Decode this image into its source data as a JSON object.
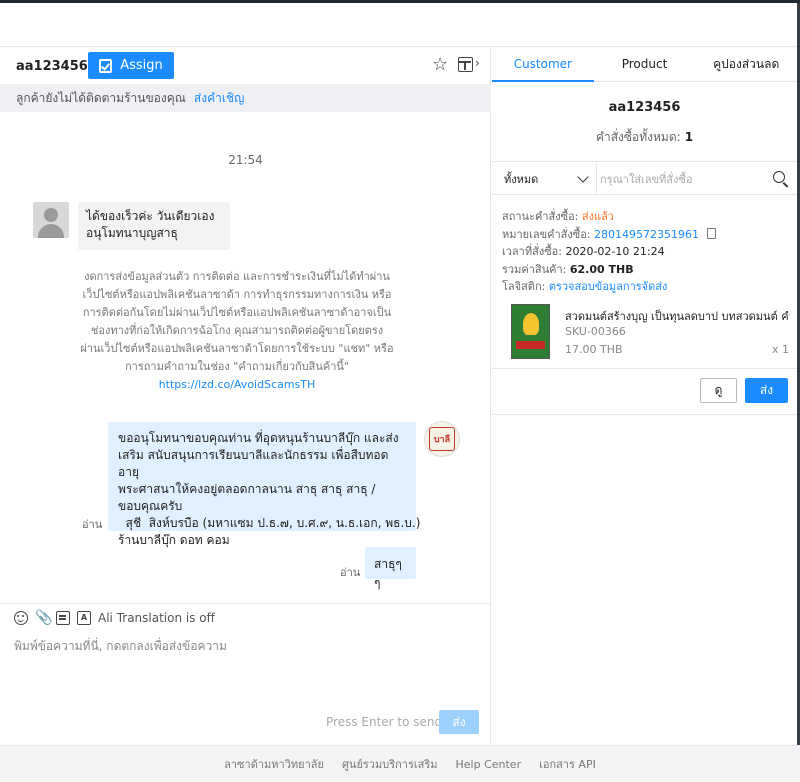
{
  "chat": {
    "username": "aa123456",
    "assign_label": "Assign",
    "invite_text": "ลูกค้ายังไม่ได้ติดตามร้านของคุณ",
    "invite_link": "ส่งคำเชิญ",
    "time": "21:54",
    "message_in": {
      "line1": "ได้ของเร็วค่ะ  วันเดียวเอง",
      "line2": "อนุโมทนาบุญสาธุ"
    },
    "notice": {
      "lines": [
        "งดการส่งข้อมูลส่วนตัว การติดต่อ และการชำระเงินที่ไม่ได้ทำผ่าน",
        "เว็ปไซต์หรือแอปพลิเคชันลาซาด้า การทำธุรกรรมทางการเงิน หรือ",
        "การติดต่อกันโดยไม่ผ่านเว็ปไซต์หรือแอปพลิเคชันลาซาด้าอาจเป็น",
        "ช่องทางที่ก่อให้เกิดการฉ้อโกง คุณสามารถติดต่อผู้ขายโดยตรง",
        "ผ่านเว็ปไซต์หรือแอปพลิเคชันลาซาด้าโดยการใช้ระบบ \"แชท\" หรือ",
        "การถามคำถามในช่อง \"คำถามเกี่ยวกับสินค้านี้\""
      ],
      "link": "https://lzd.co/AvoidScamsTH"
    },
    "seller_logo": "บาลี",
    "message_out1": {
      "lines": [
        "ขออนุโมทนาขอบคุณท่าน ที่อุดหนุนร้านบาลีบุ๊ก และส่ง",
        "เสริม สนับสนุนการเรียนบาลีและนักธรรม เพื่อสืบทอดอายุ",
        "พระศาสนาให้คงอยู่ตลอดกาลนาน สาธุ สาธุ สาธุ  /",
        "ขอบคุณครับ",
        "  สุชี  สิงห์บรบือ (มหาแซม ป.ธ.๗, บ.ศ.๙, น.ธ.เอก, พธ.บ.)",
        "ร้านบาลีบุ๊ก ดอท คอม"
      ],
      "read": "อ่าน"
    },
    "message_out2": {
      "text": "สาธุๆๆ",
      "read": "อ่าน"
    },
    "translation_label": "Ali Translation is off",
    "input_placeholder": "พิมพ์ข้อความที่นี่, กดตกลงเพื่อส่งข้อความ",
    "press_enter": "Press Enter to send",
    "send_label": "ส่ง"
  },
  "side": {
    "tabs": [
      {
        "label": "Customer"
      },
      {
        "label": "Product"
      },
      {
        "label": "คูปองส่วนลด"
      }
    ],
    "customer_name": "aa123456",
    "order_count_label": "คำสั่งซื้อทั้งหมด:",
    "order_count": "1",
    "filter_value": "ทั้งหมด",
    "search_placeholder": "กรุณาใส่เลขที่สั่งซื้อ",
    "order": {
      "status_label": "สถานะคำสั่งซื้อ:",
      "status": "ส่งแล้ว",
      "number_label": "หมายเลขคำสั่งซื้อ:",
      "number": "280149572351961",
      "time_label": "เวลาที่สั่งซื้อ:",
      "time": "2020-02-10 21:24",
      "total_label": "รวมค่าสินค้า:",
      "total": "62.00 THB",
      "logistics_label": "โลจิสติก:",
      "logistics_link": "ตรวจสอบข้อมูลการจัดส่ง"
    },
    "product": {
      "title": "สวดมนต์สร้างบุญ เป็นทุนลดบาป บทสวดมนต์ คำอ่าน",
      "sku": "SKU-00366",
      "price": "17.00 THB",
      "qty": "x 1"
    },
    "view_label": "ดู",
    "send_label": "ส่ง"
  },
  "footer": {
    "links": [
      "ลาซาด้ามหาวิทยาลัย",
      "ศูนย์รวมบริการเสริม",
      "Help Center",
      "เอกสาร API"
    ]
  },
  "colors": {
    "accent": "#1a8cff",
    "status_orange": "#f57224",
    "bubble_out": "#e0f0ff",
    "bubble_in": "#f2f3f5"
  }
}
